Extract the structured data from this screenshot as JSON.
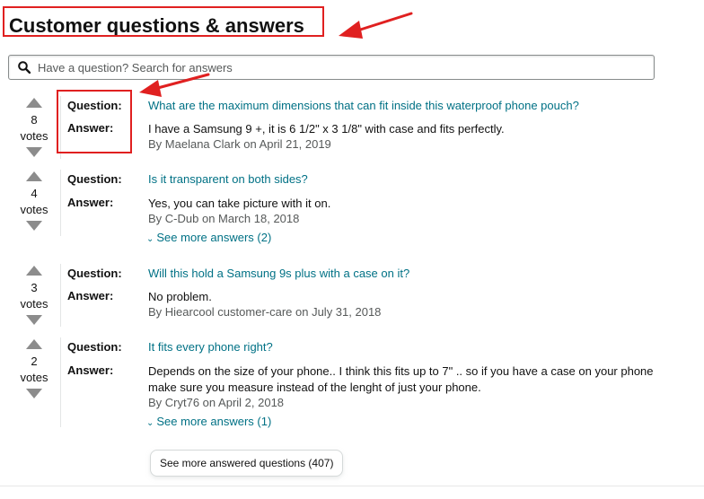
{
  "heading": "Customer questions & answers",
  "search": {
    "placeholder": "Have a question? Search for answers"
  },
  "labels": {
    "question": "Question:",
    "answer": "Answer:",
    "votes": "votes"
  },
  "items": [
    {
      "votes": "8",
      "question": "What are the maximum dimensions that can fit inside this waterproof phone pouch?",
      "answer": "I have a Samsung 9 +, it is 6 1/2\" x 3 1/8\" with case and fits perfectly.",
      "byline": "By Maelana Clark on April 21, 2019"
    },
    {
      "votes": "4",
      "question": "Is it transparent on both sides?",
      "answer": "Yes, you can take picture with it on.",
      "byline": "By C-Dub on March 18, 2018",
      "more": "See more answers (2)"
    },
    {
      "votes": "3",
      "question": "Will this hold a Samsung 9s plus with a case on it?",
      "answer": "No problem.",
      "byline": "By Hiearcool customer-care on July 31, 2018"
    },
    {
      "votes": "2",
      "question": "It fits every phone right?",
      "answer": "Depends on the size of your phone.. I think this fits up to 7\" .. so if you have a case on your phone make sure you measure instead of the lenght of just your phone.",
      "byline": "By Cryt76 on April 2, 2018",
      "more": "See more answers (1)"
    }
  ],
  "see_more_button": "See more answered questions (407)",
  "colors": {
    "link": "#007185",
    "annotation": "#e02020"
  }
}
